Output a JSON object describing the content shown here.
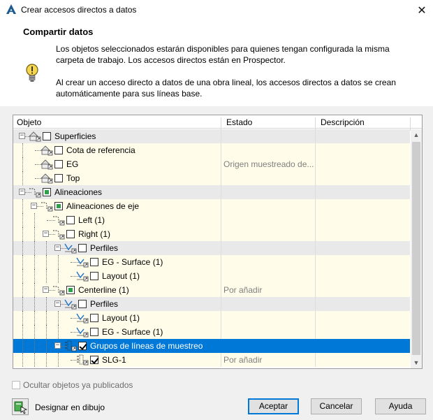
{
  "window": {
    "title": "Crear accesos directos a datos",
    "close_glyph": "✕"
  },
  "header": {
    "title": "Compartir datos",
    "paragraph1": "Los objetos seleccionados estarán disponibles para quienes tengan configurada la misma carpeta de trabajo. Los accesos directos están en Prospector.",
    "paragraph2": "Al crear un acceso directo a datos de una obra lineal, los accesos directos a datos se crean automáticamente para sus líneas base.",
    "icon": "lightbulb-icon"
  },
  "grid": {
    "columns": [
      "Objeto",
      "Estado",
      "Descripción"
    ],
    "rows": [
      {
        "name": "Superficies",
        "estado": "",
        "icon": "surface-icon",
        "check": "none",
        "expander": "−",
        "type": "group"
      },
      {
        "name": "Cota de referencia",
        "estado": "",
        "icon": "surface-icon",
        "check": "none",
        "expander": "",
        "type": "item"
      },
      {
        "name": "EG",
        "estado": "Origen muestreado de...",
        "icon": "surface-icon",
        "check": "none",
        "expander": "",
        "type": "item"
      },
      {
        "name": "Top",
        "estado": "",
        "icon": "surface-icon",
        "check": "none",
        "expander": "",
        "type": "item"
      },
      {
        "name": "Alineaciones",
        "estado": "",
        "icon": "alignment-icon",
        "check": "partial",
        "expander": "−",
        "type": "group"
      },
      {
        "name": "Alineaciones de eje",
        "estado": "",
        "icon": "alignment-icon",
        "check": "partial",
        "expander": "−",
        "type": "item"
      },
      {
        "name": "Left (1)",
        "estado": "",
        "icon": "alignment-icon",
        "check": "none",
        "expander": "",
        "type": "item"
      },
      {
        "name": "Right (1)",
        "estado": "",
        "icon": "alignment-icon",
        "check": "none",
        "expander": "−",
        "type": "item"
      },
      {
        "name": "Perfiles",
        "estado": "",
        "icon": "profile-icon",
        "check": "none",
        "expander": "−",
        "type": "group"
      },
      {
        "name": "EG - Surface (1)",
        "estado": "",
        "icon": "profile-icon",
        "check": "none",
        "expander": "",
        "type": "item"
      },
      {
        "name": "Layout (1)",
        "estado": "",
        "icon": "profile-icon",
        "check": "none",
        "expander": "",
        "type": "item"
      },
      {
        "name": "Centerline (1)",
        "estado": "Por añadir",
        "icon": "alignment-icon",
        "check": "partial",
        "expander": "−",
        "type": "item"
      },
      {
        "name": "Perfiles",
        "estado": "",
        "icon": "profile-icon",
        "check": "none",
        "expander": "−",
        "type": "group"
      },
      {
        "name": "Layout (1)",
        "estado": "",
        "icon": "profile-icon",
        "check": "none",
        "expander": "",
        "type": "item"
      },
      {
        "name": "EG - Surface (1)",
        "estado": "",
        "icon": "profile-icon",
        "check": "none",
        "expander": "",
        "type": "item"
      },
      {
        "name": "Grupos de líneas de muestreo",
        "estado": "",
        "icon": "sample-line-group-icon",
        "check": "checked",
        "expander": "−",
        "type": "selected"
      },
      {
        "name": "SLG-1",
        "estado": "Por añadir",
        "icon": "sample-line-group-icon",
        "check": "checked",
        "expander": "",
        "type": "item"
      }
    ]
  },
  "footer": {
    "hide_published_label": "Ocultar objetos ya publicados",
    "designate_label": "Designar en dibujo",
    "accept_label": "Aceptar",
    "cancel_label": "Cancelar",
    "help_label": "Ayuda"
  }
}
